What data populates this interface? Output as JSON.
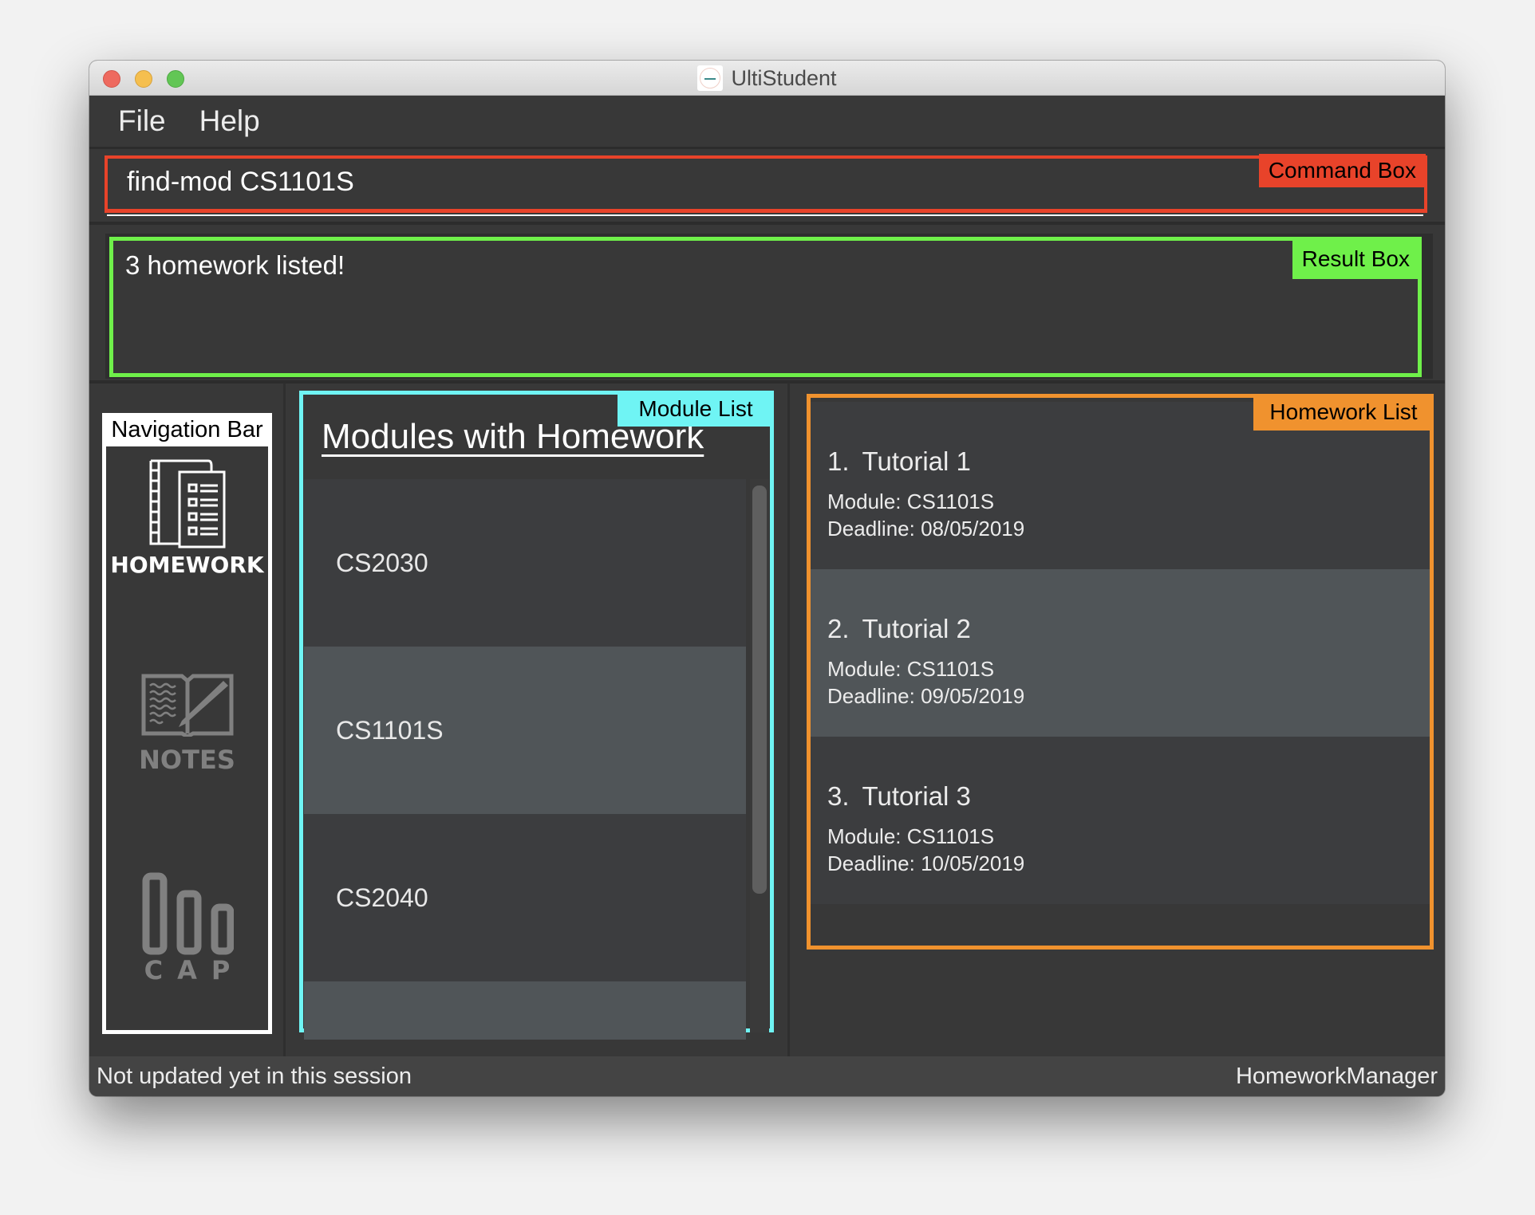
{
  "window": {
    "title": "UltiStudent",
    "controls": [
      "close",
      "minimize",
      "maximize"
    ]
  },
  "menu": {
    "items": [
      {
        "label": "File"
      },
      {
        "label": "Help"
      }
    ]
  },
  "command_box": {
    "annotation": "Command Box",
    "value": "find-mod CS1101S",
    "color": "#e8432a"
  },
  "result_box": {
    "annotation": "Result Box",
    "text": "3 homework listed!",
    "color": "#6ff04a"
  },
  "navigation": {
    "annotation": "Navigation Bar",
    "items": [
      {
        "label": "HOMEWORK",
        "icon": "homework-checklist-icon",
        "active": true
      },
      {
        "label": "NOTES",
        "icon": "notebook-pen-icon",
        "active": false
      },
      {
        "label": "CAP",
        "icon": "bar-chart-icon",
        "active": false
      }
    ]
  },
  "module_list": {
    "annotation": "Module List",
    "title": "Modules with Homework",
    "color": "#6ff4f4",
    "items": [
      {
        "code": "CS2030"
      },
      {
        "code": "CS1101S"
      },
      {
        "code": "CS2040"
      },
      {
        "code": ""
      }
    ]
  },
  "homework_list": {
    "annotation": "Homework List",
    "color": "#f0922e",
    "items": [
      {
        "index": "1.",
        "name": "Tutorial 1",
        "module": "Module: CS1101S",
        "deadline": "Deadline: 08/05/2019"
      },
      {
        "index": "2.",
        "name": "Tutorial 2",
        "module": "Module: CS1101S",
        "deadline": "Deadline: 09/05/2019"
      },
      {
        "index": "3.",
        "name": "Tutorial 3",
        "module": "Module: CS1101S",
        "deadline": "Deadline: 10/05/2019"
      }
    ]
  },
  "status_bar": {
    "left": "Not updated yet in this session",
    "right": "HomeworkManager"
  }
}
